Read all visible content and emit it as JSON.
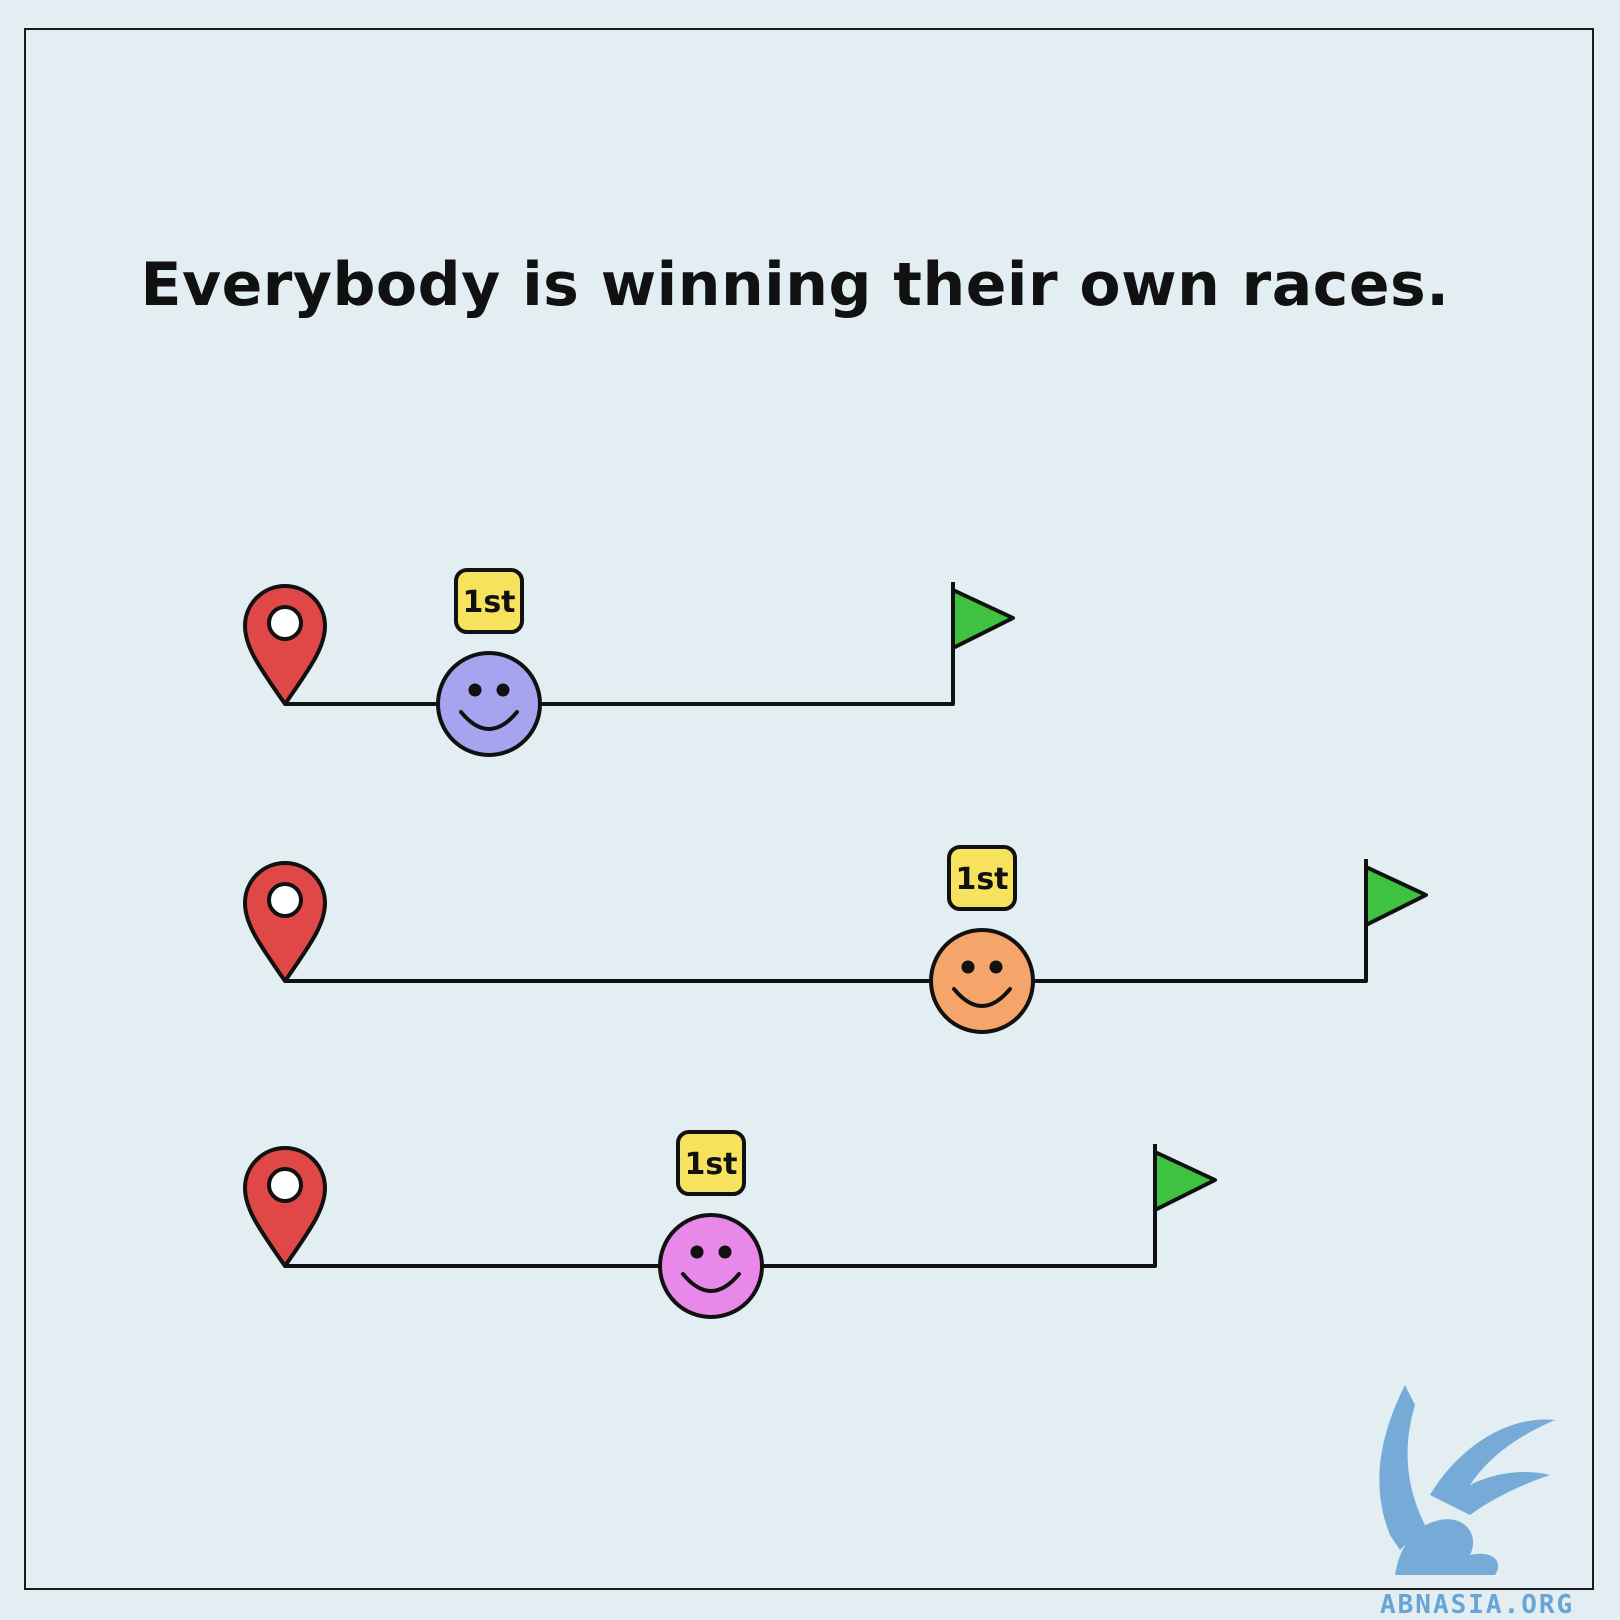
{
  "title": "Everybody is winning their own races.",
  "watermark": {
    "text": "ABNASIA.ORG",
    "color": "#6aa4d4"
  },
  "colors": {
    "background": "#e2eef2",
    "pin": "#e04848",
    "flag": "#3fc23f",
    "badge": "#f7e25e",
    "stroke": "#111111"
  },
  "races": [
    {
      "badge": "1st",
      "face_color": "#a7a4ef",
      "icons": [
        "location-pin-icon",
        "smiley-face-icon",
        "finish-flag-icon"
      ]
    },
    {
      "badge": "1st",
      "face_color": "#f6a56a",
      "icons": [
        "location-pin-icon",
        "smiley-face-icon",
        "finish-flag-icon"
      ]
    },
    {
      "badge": "1st",
      "face_color": "#e888e8",
      "icons": [
        "location-pin-icon",
        "smiley-face-icon",
        "finish-flag-icon"
      ]
    }
  ]
}
